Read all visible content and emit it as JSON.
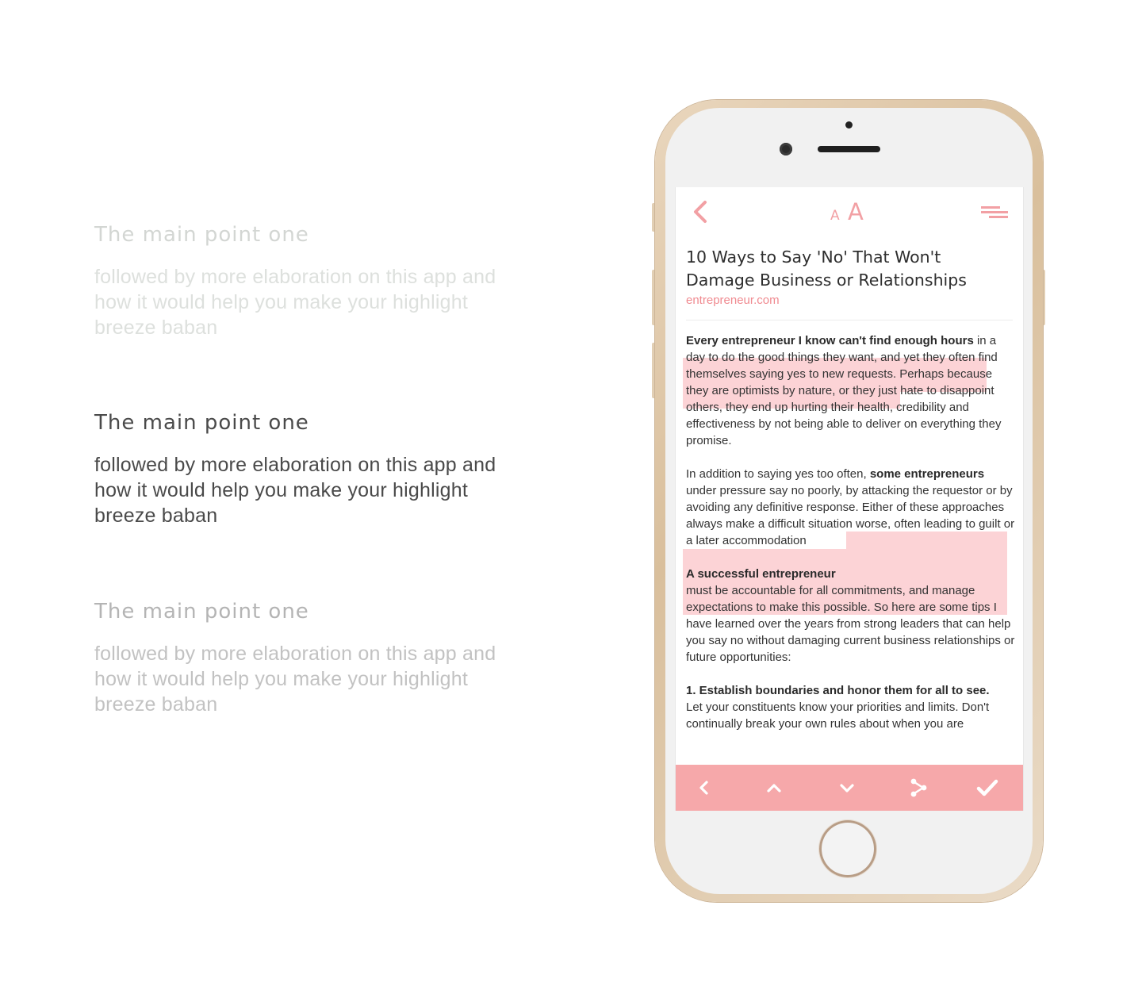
{
  "features": [
    {
      "title": "The main point one",
      "body": "followed by more elaboration on this app and how it would help you make your highlight breeze baban"
    },
    {
      "title": "The main point one",
      "body": "followed by more elaboration on this app and how it would help you make your highlight breeze baban"
    },
    {
      "title": "The main point one",
      "body": "followed by more elaboration on this app and how it would help you make your highlight breeze baban"
    }
  ],
  "reader": {
    "toolbar": {
      "back_icon": "chevron-left-icon",
      "font_small": "A",
      "font_large": "A",
      "menu_icon": "lines-icon"
    },
    "article": {
      "title": "10 Ways to Say 'No' That Won't Damage Business or Relationships",
      "source": "entrepreneur.com",
      "p1_bold": "Every entrepreneur I know can't find enough hours",
      "p1_rest": " in a day to do the good things they want, and yet they often find themselves saying yes to new requests. Perhaps because they are optimists by nature, or they just hate to disappoint others, they end up hurting their health, credibility and effectiveness by not being able to deliver on everything they promise.",
      "p2_start": "In addition to saying yes too often, ",
      "p2_bold": "some entrepreneurs",
      "p2_rest": " under pressure say no poorly, by attacking the requestor or by avoiding any definitive response. Either of these approaches always make a difficult situation worse, often leading to guilt or a later accommodation",
      "p3_bold": "A successful entrepreneur",
      "p3_rest": "must be accountable for all commitments, and manage expectations to make this possible. So here are some tips I have learned over the years from strong leaders that can help you say no without damaging current business relationships or future opportunities:",
      "p4_bold": "1. Establish boundaries and honor them for all to see.",
      "p4_rest": "Let your constituents know your priorities and limits. Don't continually break your own rules about when you are"
    },
    "bottom_bar": [
      "chevron-left-icon",
      "chevron-up-icon",
      "chevron-down-icon",
      "share-icon",
      "checkmark-icon"
    ],
    "accent_color": "#f6a8aa"
  }
}
